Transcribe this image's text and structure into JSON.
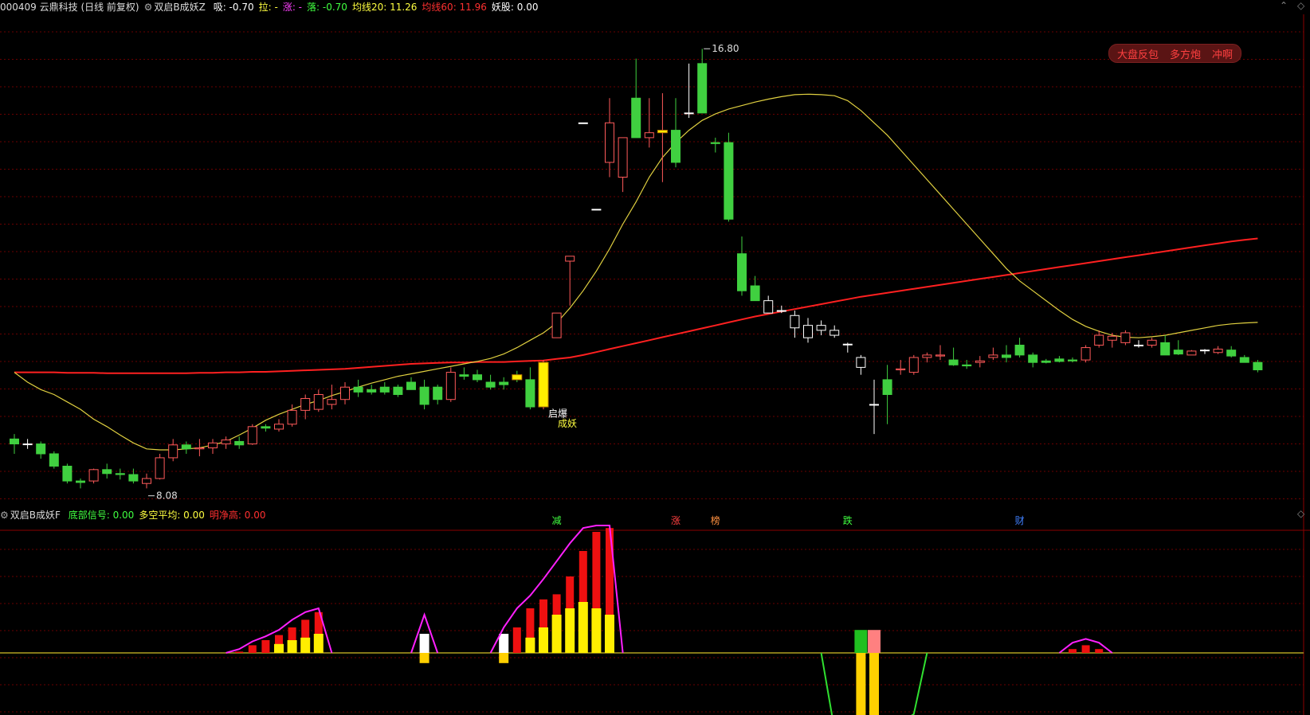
{
  "header": {
    "stock": "000409 云鼎科技 (日线 前复权)",
    "indicator": "双启B成妖Z",
    "items": [
      {
        "label": "吸:",
        "value": "-0.70",
        "color": "#ffffff"
      },
      {
        "label": "拉:",
        "value": "-",
        "color": "#ffff40"
      },
      {
        "label": "涨:",
        "value": "-",
        "color": "#ff40ff"
      },
      {
        "label": "落:",
        "value": "-0.70",
        "color": "#40ff40"
      },
      {
        "label": "均线20:",
        "value": "11.26",
        "color": "#ffff40"
      },
      {
        "label": "均线60:",
        "value": "11.96",
        "color": "#ff3030"
      },
      {
        "label": "妖股:",
        "value": "0.00",
        "color": "#ffffff"
      }
    ]
  },
  "sub_header": {
    "indicator": "双启B成妖F",
    "items": [
      {
        "label": "底部信号:",
        "value": "0.00",
        "color": "#40ff40"
      },
      {
        "label": "多空平均:",
        "value": "0.00",
        "color": "#ffff40"
      },
      {
        "label": "明净高:",
        "value": "0.00",
        "color": "#ff3030"
      }
    ]
  },
  "buttons": [
    "大盘反包",
    "多方炮",
    "冲啊"
  ],
  "annotations": {
    "high_label": "16.80",
    "low_label": "8.08",
    "signal_top": "启爆",
    "signal_bottom": "成妖"
  },
  "events": [
    {
      "text": "减",
      "color": "#40ff40",
      "idx": 41
    },
    {
      "text": "涨",
      "color": "#ff4040",
      "idx": 50
    },
    {
      "text": "榜",
      "color": "#ff9040",
      "idx": 53
    },
    {
      "text": "跌",
      "color": "#40ff40",
      "idx": 63
    },
    {
      "text": "财",
      "color": "#4080ff",
      "idx": 76
    }
  ],
  "colors": {
    "up": "#ff5a5a",
    "down": "#40d040",
    "flat": "#ffffff",
    "ma20": "#e0d040",
    "ma60": "#ff2020",
    "grid": "#6a0000"
  },
  "chart_data": [
    {
      "type": "candlestick",
      "ylim": [
        7.6,
        17.4
      ],
      "candles": [
        [
          8.9,
          9.0,
          8.6,
          8.8
        ],
        [
          8.8,
          8.9,
          8.7,
          8.8
        ],
        [
          8.8,
          8.85,
          8.5,
          8.6
        ],
        [
          8.6,
          8.65,
          8.3,
          8.35
        ],
        [
          8.35,
          8.4,
          8.0,
          8.05
        ],
        [
          8.05,
          8.1,
          7.9,
          8.02
        ],
        [
          8.05,
          8.3,
          8.0,
          8.28
        ],
        [
          8.28,
          8.4,
          8.1,
          8.2
        ],
        [
          8.2,
          8.3,
          8.08,
          8.18
        ],
        [
          8.18,
          8.3,
          8.0,
          8.05
        ],
        [
          8.0,
          8.2,
          7.9,
          8.1
        ],
        [
          8.1,
          8.6,
          8.08,
          8.52
        ],
        [
          8.52,
          8.9,
          8.45,
          8.78
        ],
        [
          8.78,
          8.85,
          8.6,
          8.7
        ],
        [
          8.7,
          8.9,
          8.55,
          8.72
        ],
        [
          8.72,
          8.9,
          8.6,
          8.82
        ],
        [
          8.8,
          8.95,
          8.7,
          8.88
        ],
        [
          8.85,
          8.95,
          8.7,
          8.78
        ],
        [
          8.8,
          9.2,
          8.78,
          9.15
        ],
        [
          9.15,
          9.2,
          9.05,
          9.12
        ],
        [
          9.1,
          9.3,
          9.05,
          9.2
        ],
        [
          9.2,
          9.6,
          9.15,
          9.48
        ],
        [
          9.48,
          9.8,
          9.3,
          9.72
        ],
        [
          9.5,
          9.9,
          9.45,
          9.8
        ],
        [
          9.6,
          10.0,
          9.5,
          9.7
        ],
        [
          9.7,
          10.05,
          9.6,
          9.95
        ],
        [
          9.95,
          10.1,
          9.75,
          9.85
        ],
        [
          9.9,
          10.0,
          9.8,
          9.85
        ],
        [
          9.95,
          10.05,
          9.8,
          9.85
        ],
        [
          9.95,
          10.0,
          9.75,
          9.8
        ],
        [
          10.05,
          10.15,
          9.9,
          9.9
        ],
        [
          9.95,
          10.1,
          9.5,
          9.6
        ],
        [
          9.95,
          10.0,
          9.6,
          9.7
        ],
        [
          9.7,
          10.35,
          9.65,
          10.25
        ],
        [
          10.2,
          10.35,
          10.1,
          10.17
        ],
        [
          10.2,
          10.3,
          10.05,
          10.1
        ],
        [
          10.05,
          10.2,
          9.9,
          9.95
        ],
        [
          10.05,
          10.15,
          9.9,
          10.0
        ],
        [
          10.2,
          10.28,
          10.05,
          10.1
        ],
        [
          10.1,
          10.35,
          9.5,
          9.55
        ],
        [
          9.55,
          10.5,
          9.5,
          10.45
        ],
        [
          10.95,
          11.45,
          10.95,
          11.45
        ],
        [
          12.5,
          12.6,
          11.6,
          12.6
        ],
        [
          15.3,
          15.3,
          15.3,
          15.3
        ],
        [
          13.55,
          13.55,
          13.55,
          13.55
        ],
        [
          14.5,
          15.8,
          14.2,
          15.3
        ],
        [
          14.2,
          15.0,
          13.9,
          15.0
        ],
        [
          15.8,
          16.6,
          15.0,
          15.0
        ],
        [
          15.0,
          15.8,
          14.8,
          15.1
        ],
        [
          15.1,
          15.9,
          14.1,
          15.15
        ],
        [
          15.15,
          15.8,
          14.4,
          14.5
        ],
        [
          15.5,
          16.5,
          15.4,
          15.5
        ],
        [
          16.5,
          16.8,
          15.5,
          15.5
        ],
        [
          14.9,
          15.0,
          14.7,
          14.88
        ],
        [
          14.9,
          15.1,
          13.3,
          13.35
        ],
        [
          12.65,
          13.0,
          11.8,
          11.9
        ],
        [
          12.0,
          12.2,
          11.7,
          11.7
        ],
        [
          11.7,
          11.8,
          11.45,
          11.45
        ],
        [
          11.5,
          11.6,
          11.45,
          11.5
        ],
        [
          11.4,
          11.5,
          10.95,
          11.15
        ],
        [
          11.2,
          11.35,
          10.85,
          10.95
        ],
        [
          11.2,
          11.3,
          11.0,
          11.1
        ],
        [
          11.1,
          11.2,
          10.95,
          11.0
        ],
        [
          10.82,
          10.85,
          10.65,
          10.82
        ],
        [
          10.55,
          10.6,
          10.2,
          10.35
        ],
        [
          9.6,
          10.1,
          9.0,
          9.6
        ],
        [
          10.1,
          10.4,
          9.2,
          9.8
        ],
        [
          10.3,
          10.5,
          10.2,
          10.32
        ],
        [
          10.25,
          10.6,
          10.2,
          10.55
        ],
        [
          10.55,
          10.65,
          10.45,
          10.6
        ],
        [
          10.58,
          10.8,
          10.5,
          10.6
        ],
        [
          10.5,
          10.75,
          10.38,
          10.4
        ],
        [
          10.4,
          10.5,
          10.32,
          10.38
        ],
        [
          10.45,
          10.58,
          10.35,
          10.48
        ],
        [
          10.55,
          10.75,
          10.5,
          10.6
        ],
        [
          10.6,
          10.8,
          10.45,
          10.55
        ],
        [
          10.8,
          10.95,
          10.55,
          10.6
        ],
        [
          10.6,
          10.65,
          10.35,
          10.45
        ],
        [
          10.48,
          10.52,
          10.43,
          10.45
        ],
        [
          10.52,
          10.58,
          10.45,
          10.47
        ],
        [
          10.5,
          10.55,
          10.45,
          10.48
        ],
        [
          10.5,
          10.8,
          10.45,
          10.75
        ],
        [
          10.8,
          11.1,
          10.75,
          11.0
        ],
        [
          10.9,
          11.05,
          10.75,
          10.98
        ],
        [
          10.85,
          11.1,
          10.8,
          11.05
        ],
        [
          10.8,
          10.9,
          10.75,
          10.8
        ],
        [
          10.8,
          10.95,
          10.75,
          10.9
        ],
        [
          10.85,
          11.0,
          10.6,
          10.6
        ],
        [
          10.7,
          10.9,
          10.6,
          10.62
        ],
        [
          10.6,
          10.7,
          10.6,
          10.68
        ],
        [
          10.7,
          10.72,
          10.62,
          10.7
        ],
        [
          10.65,
          10.78,
          10.62,
          10.72
        ],
        [
          10.7,
          10.78,
          10.55,
          10.58
        ],
        [
          10.55,
          10.6,
          10.45,
          10.45
        ],
        [
          10.45,
          10.5,
          10.25,
          10.3
        ]
      ],
      "ma20": [
        10.25,
        10.05,
        9.9,
        9.8,
        9.65,
        9.5,
        9.3,
        9.15,
        8.98,
        8.82,
        8.7,
        8.68,
        8.68,
        8.7,
        8.72,
        8.78,
        8.85,
        8.98,
        9.12,
        9.28,
        9.4,
        9.5,
        9.6,
        9.68,
        9.78,
        9.86,
        9.95,
        10.03,
        10.1,
        10.17,
        10.22,
        10.27,
        10.32,
        10.37,
        10.42,
        10.47,
        10.53,
        10.62,
        10.75,
        10.9,
        11.05,
        11.25,
        11.55,
        11.9,
        12.3,
        12.75,
        13.25,
        13.7,
        14.2,
        14.6,
        14.9,
        15.15,
        15.35,
        15.48,
        15.58,
        15.65,
        15.72,
        15.78,
        15.83,
        15.87,
        15.88,
        15.87,
        15.85,
        15.75,
        15.55,
        15.3,
        15.05,
        14.75,
        14.45,
        14.15,
        13.85,
        13.55,
        13.25,
        12.95,
        12.65,
        12.35,
        12.1,
        11.9,
        11.7,
        11.5,
        11.32,
        11.18,
        11.08,
        11.0,
        10.96,
        10.95,
        10.97,
        11.0,
        11.05,
        11.1,
        11.15,
        11.2,
        11.23,
        11.25,
        11.26
      ],
      "ma60": [
        10.25,
        10.25,
        10.25,
        10.25,
        10.24,
        10.24,
        10.24,
        10.23,
        10.23,
        10.23,
        10.23,
        10.23,
        10.23,
        10.23,
        10.24,
        10.24,
        10.25,
        10.25,
        10.26,
        10.26,
        10.27,
        10.28,
        10.29,
        10.3,
        10.31,
        10.32,
        10.34,
        10.36,
        10.38,
        10.4,
        10.42,
        10.43,
        10.44,
        10.45,
        10.45,
        10.46,
        10.46,
        10.46,
        10.47,
        10.48,
        10.49,
        10.52,
        10.55,
        10.6,
        10.66,
        10.72,
        10.78,
        10.84,
        10.9,
        10.96,
        11.02,
        11.08,
        11.14,
        11.2,
        11.26,
        11.32,
        11.38,
        11.43,
        11.48,
        11.53,
        11.58,
        11.63,
        11.68,
        11.73,
        11.78,
        11.82,
        11.86,
        11.9,
        11.94,
        11.98,
        12.02,
        12.06,
        12.1,
        12.14,
        12.18,
        12.22,
        12.26,
        12.3,
        12.34,
        12.38,
        12.42,
        12.46,
        12.5,
        12.54,
        12.58,
        12.62,
        12.66,
        12.7,
        12.74,
        12.78,
        12.82,
        12.86,
        12.9,
        12.93,
        12.96
      ]
    },
    {
      "type": "bar",
      "name_hint": "sub-indicator",
      "ylim": [
        -5,
        10
      ],
      "groups": [
        {
          "idx": [
            17,
            18,
            19,
            20,
            21,
            22,
            23
          ],
          "red": [
            0.1,
            0.6,
            1.0,
            1.4,
            2.0,
            2.6,
            3.2
          ],
          "yellow": [
            0,
            0,
            0,
            0.7,
            1.0,
            1.2,
            1.5
          ],
          "line": [
            0.3,
            0.9,
            1.3,
            1.8,
            2.6,
            3.2,
            3.5
          ]
        },
        {
          "idx": [
            31
          ],
          "red": [
            0
          ],
          "yellow": [
            -0.8
          ],
          "white": [
            1.5
          ],
          "line": [
            3.0
          ]
        },
        {
          "idx": [
            37,
            38,
            39,
            40,
            41,
            42,
            43,
            44,
            45
          ],
          "red": [
            1.5,
            2.0,
            3.5,
            4.2,
            4.6,
            6.0,
            8.0,
            9.5,
            9.8
          ],
          "yellow": [
            -0.8,
            0,
            1.2,
            2.0,
            3.0,
            3.5,
            4.0,
            3.5,
            3.0
          ],
          "white": [
            1.5,
            0,
            0,
            0,
            0,
            0,
            0,
            0,
            0
          ],
          "line": [
            2.0,
            3.5,
            4.5,
            5.8,
            7.2,
            8.6,
            9.8,
            10.0,
            10.0
          ]
        },
        {
          "idx": [
            64,
            65
          ],
          "topGreen": [
            1.8
          ],
          "topPink": [
            1.8
          ],
          "yellow": [
            -7.0,
            -7.0
          ]
        },
        {
          "idx": [
            80,
            81,
            82
          ],
          "red": [
            0.3,
            0.6,
            0.3
          ],
          "line": [
            0.8,
            1.1,
            0.8
          ]
        }
      ],
      "green_curve": [
        [
          61,
          0
        ],
        [
          62,
          -6
        ],
        [
          63,
          -7.2
        ],
        [
          64,
          -7.2
        ],
        [
          65,
          -7.2
        ],
        [
          66,
          -7.0
        ],
        [
          67,
          -5.5
        ],
        [
          68,
          -4.8
        ],
        [
          69,
          0
        ]
      ]
    }
  ]
}
